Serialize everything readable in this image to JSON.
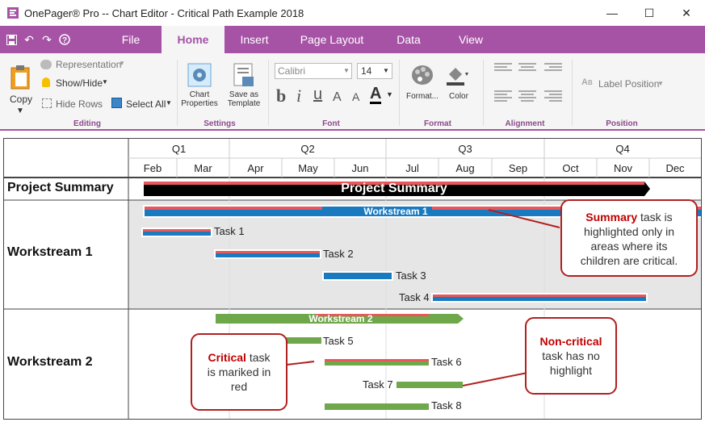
{
  "window": {
    "title": "OnePager® Pro --  Chart Editor - Critical Path Example 2018",
    "minimize_glyph": "—",
    "maximize_glyph": "☐",
    "close_glyph": "✕"
  },
  "tabs": [
    {
      "label": "File"
    },
    {
      "label": "Home"
    },
    {
      "label": "Insert"
    },
    {
      "label": "Page Layout"
    },
    {
      "label": "Data"
    },
    {
      "label": "View"
    }
  ],
  "ribbon": {
    "editing": {
      "label": "Editing",
      "copy": "Copy",
      "representation": "Representation",
      "show_hide": "Show/Hide",
      "hide_rows": "Hide Rows",
      "select_all": "Select All"
    },
    "settings": {
      "label": "Settings",
      "chart_properties_1": "Chart",
      "chart_properties_2": "Properties",
      "save_template_1": "Save as",
      "save_template_2": "Template"
    },
    "font": {
      "label": "Font",
      "family": "Calibri",
      "size": "14",
      "bold": "b",
      "italic": "i",
      "underline": "u",
      "grow": "A",
      "shrink": "A",
      "color": "A"
    },
    "format": {
      "label": "Format",
      "format_btn": "Format...",
      "color_btn": "Color"
    },
    "alignment": {
      "label": "Alignment"
    },
    "position": {
      "label": "Position",
      "label_position": "Label Position"
    }
  },
  "chart": {
    "quarters": [
      "Q1",
      "Q2",
      "Q3",
      "Q4"
    ],
    "months": [
      "Feb",
      "Mar",
      "Apr",
      "May",
      "Jun",
      "Jul",
      "Aug",
      "Sep",
      "Oct",
      "Nov",
      "Dec"
    ],
    "rows": [
      {
        "label": "Project Summary"
      },
      {
        "label": "Workstream 1"
      },
      {
        "label": "Workstream 2"
      }
    ],
    "summary_bar": "Project Summary",
    "ws1_bar": "Workstream 1",
    "ws2_bar": "Workstream 2",
    "tasks": {
      "t1": "Task 1",
      "t2": "Task 2",
      "t3": "Task 3",
      "t4": "Task 4",
      "t5": "Task 5",
      "t6": "Task 6",
      "t7": "Task 7",
      "t8": "Task 8"
    },
    "colors": {
      "critical": "#e8575a",
      "blue": "#1a7ac0",
      "green": "#6fa84a",
      "summary": "#000000",
      "shade": "#e6e6e6",
      "callout_border": "#b02020"
    }
  },
  "callouts": {
    "summary": {
      "bold": "Summary",
      "rest_1": " task is",
      "line2": "highlighted only in",
      "line3": "areas where its",
      "line4": "children are critical."
    },
    "critical": {
      "bold": "Critical",
      "rest_1": " task",
      "line2": "is mariked in",
      "line3": "red"
    },
    "noncritical": {
      "bold": "Non-critical",
      "line2": "task has no",
      "line3": "highlight"
    }
  }
}
